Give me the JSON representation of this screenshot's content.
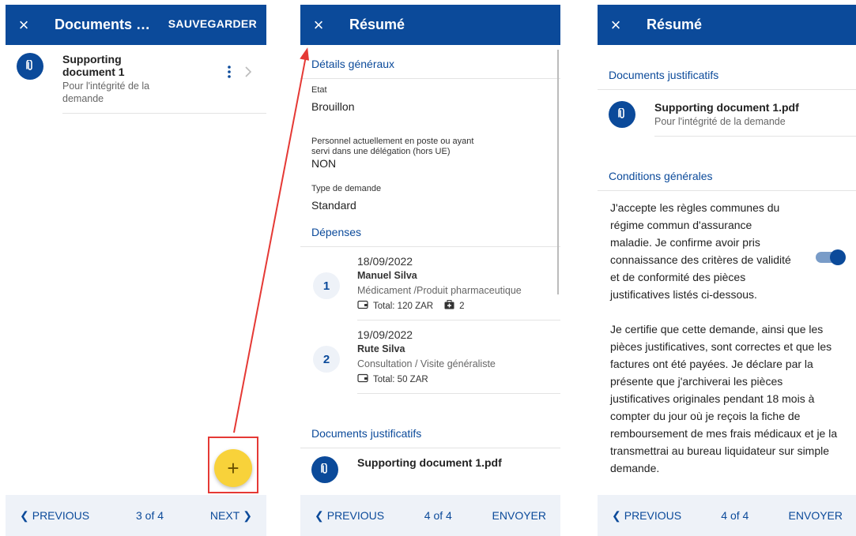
{
  "panel1": {
    "close_icon": "×",
    "title": "Documents …",
    "save_label": "SAUVEGARDER",
    "doc": {
      "title": "Supporting document 1",
      "subtitle": "Pour l'intégrité de la demande"
    },
    "fab_label": "+",
    "bottom": {
      "prev": "PREVIOUS",
      "pager": "3 of 4",
      "next": "NEXT"
    }
  },
  "panel2": {
    "close_icon": "×",
    "title": "Résumé",
    "general_header": "Détails généraux",
    "fields": [
      {
        "label": "Etat",
        "value": "Brouillon"
      },
      {
        "label": "Personnel actuellement en poste ou ayant servi dans une délégation (hors UE)",
        "value": "NON"
      },
      {
        "label": "Type de demande",
        "value": "Standard"
      }
    ],
    "expenses_header": "Dépenses",
    "expenses": [
      {
        "num": "1",
        "date": "18/09/2022",
        "name": "Manuel Silva",
        "desc": "Médicament /Produit pharmaceutique",
        "total": "Total: 120 ZAR",
        "count": "2"
      },
      {
        "num": "2",
        "date": "19/09/2022",
        "name": "Rute Silva",
        "desc": "Consultation / Visite généraliste",
        "total": "Total: 50 ZAR"
      }
    ],
    "docs_header": "Documents justificatifs",
    "doc": {
      "title": "Supporting document 1.pdf"
    },
    "bottom": {
      "prev": "PREVIOUS",
      "pager": "4 of 4",
      "send": "ENVOYER"
    }
  },
  "panel3": {
    "close_icon": "×",
    "title": "Résumé",
    "docs_header": "Documents justificatifs",
    "doc": {
      "title": "Supporting document 1.pdf",
      "subtitle": "Pour l'intégrité de la demande"
    },
    "conditions_header": "Conditions générales",
    "conditions_text1": "J'accepte les règles communes du régime commun d'assurance maladie. Je confirme avoir pris connaissance des critères de validité et de conformité des pièces justificatives listés ci-dessous.",
    "conditions_text2": "Je certifie que cette demande, ainsi que les pièces justificatives, sont correctes et que les factures ont été payées. Je déclare par la présente que j'archiverai les pièces justificatives originales pendant 18 mois à compter du jour où je reçois la fiche de remboursement de mes frais médicaux et je la transmettrai au bureau liquidateur sur simple demande.",
    "toggle_on": true,
    "bottom": {
      "prev": "PREVIOUS",
      "pager": "4 of 4",
      "send": "ENVOYER"
    }
  },
  "colors": {
    "primary": "#0b4a9a",
    "fab": "#f8d23a",
    "highlight": "#e53935"
  }
}
